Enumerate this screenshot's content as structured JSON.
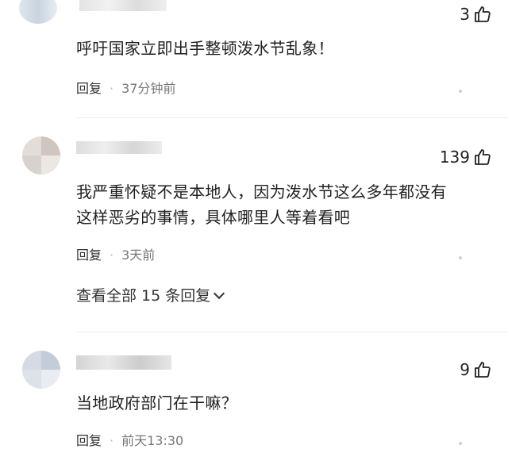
{
  "comments": [
    {
      "likes": "3",
      "text_lines": [
        "呼吁国家立即出手整顿泼水节乱象！"
      ],
      "reply_label": "回复",
      "time": "37分钟前"
    },
    {
      "likes": "139",
      "text_lines": [
        "我严重怀疑不是本地人，因为泼水节这么多年都没有",
        "这样恶劣的事情，具体哪里人等着看吧"
      ],
      "reply_label": "回复",
      "time": "3天前",
      "view_replies": "查看全部 15 条回复"
    },
    {
      "likes": "9",
      "text_lines": [
        "当地政府部门在干嘛？"
      ],
      "reply_label": "回复",
      "time": "前天13:30"
    }
  ],
  "icons": {
    "like": "thumbs-up-icon",
    "more": "more-dots-icon",
    "expand": "chevron-down-icon"
  },
  "colors": {
    "text": "#1f1f1f",
    "meta": "#777777",
    "like": "#222222"
  }
}
